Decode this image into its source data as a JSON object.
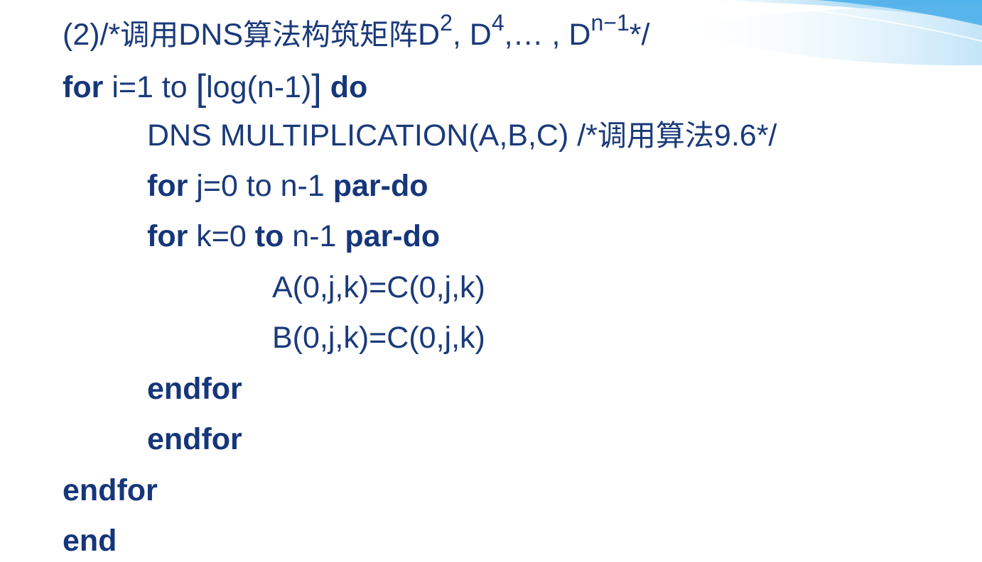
{
  "lines": [
    {
      "prefix": "(2)/*",
      "comment_cn": "调用",
      "algo": "DNS",
      "comment_cn2": "算法构筑矩阵",
      "d1": "D",
      "sup1": "2",
      "sep1": ", D",
      "sup2": "4",
      "sep2": ",… , D",
      "sup3": "n−1",
      "suffix": "*/"
    },
    {
      "kw_for": "for",
      "text1": "i=1 to ",
      "lbracket": "[",
      "text2": "log(n-1)",
      "rbracket": "]",
      "kw_do": "do"
    },
    {
      "text1": "DNS MULTIPLICATION(A,B,C) /*",
      "comment_cn": "调用算法",
      "text2": "9.6*/"
    },
    {
      "kw_for": "for",
      "text1": " j=0 to n-1 ",
      "kw_pardo": "par-do"
    },
    {
      "kw_for": "for",
      "text1": " k=0 ",
      "kw_to": "to",
      "text2": " n-1 ",
      "kw_pardo": "par-do"
    },
    {
      "text": "A(0,j,k)=C(0,j,k)"
    },
    {
      "text": "B(0,j,k)=C(0,j,k)"
    },
    {
      "kw": "endfor"
    },
    {
      "kw": "endfor"
    },
    {
      "kw": "endfor"
    },
    {
      "kw": "end"
    }
  ],
  "colors": {
    "text": "#1a3a7a",
    "accent": "#5ab4ea"
  }
}
